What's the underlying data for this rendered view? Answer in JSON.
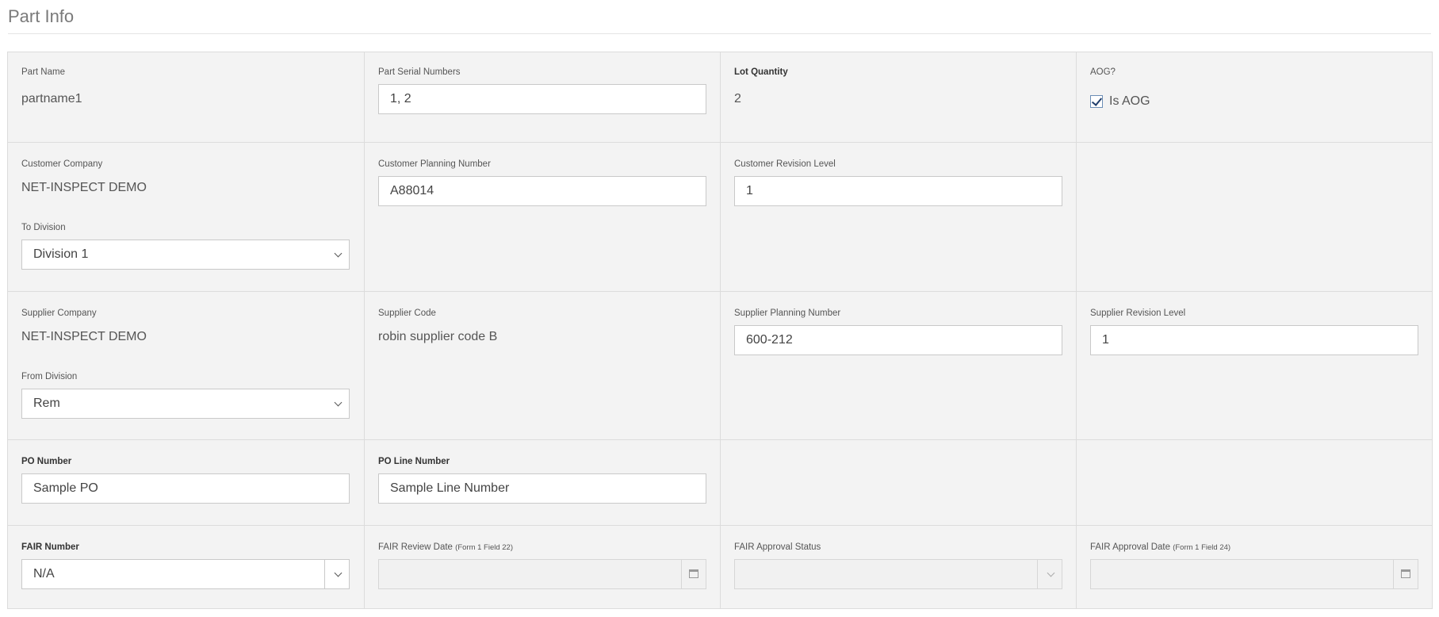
{
  "page": {
    "title": "Part Info"
  },
  "part_name": {
    "label": "Part Name",
    "value": "partname1"
  },
  "part_serial_numbers": {
    "label": "Part Serial Numbers",
    "value": "1, 2"
  },
  "lot_quantity": {
    "label": "Lot Quantity",
    "value": "2"
  },
  "aog": {
    "label": "AOG?",
    "checkbox_label": "Is AOG",
    "checked": true
  },
  "customer_company": {
    "label": "Customer Company",
    "value": "NET-INSPECT DEMO"
  },
  "to_division": {
    "label": "To Division",
    "value": "Division 1"
  },
  "customer_planning_number": {
    "label": "Customer Planning Number",
    "value": "A88014"
  },
  "customer_revision_level": {
    "label": "Customer Revision Level",
    "value": "1"
  },
  "supplier_company": {
    "label": "Supplier Company",
    "value": "NET-INSPECT DEMO"
  },
  "from_division": {
    "label": "From Division",
    "value": "Rem"
  },
  "supplier_code": {
    "label": "Supplier Code",
    "value": "robin supplier code B"
  },
  "supplier_planning_number": {
    "label": "Supplier Planning Number",
    "value": "600-212"
  },
  "supplier_revision_level": {
    "label": "Supplier Revision Level",
    "value": "1"
  },
  "po_number": {
    "label": "PO Number",
    "value": "Sample PO"
  },
  "po_line_number": {
    "label": "PO Line Number",
    "value": "Sample Line Number"
  },
  "fair_number": {
    "label": "FAIR Number",
    "value": "N/A"
  },
  "fair_review_date": {
    "label": "FAIR Review Date",
    "note": "(Form 1 Field 22)",
    "value": ""
  },
  "fair_approval_status": {
    "label": "FAIR Approval Status",
    "value": ""
  },
  "fair_approval_date": {
    "label": "FAIR Approval Date",
    "note": "(Form 1 Field 24)",
    "value": ""
  },
  "icons": {
    "select_caret": "chevron-down-icon",
    "date_picker": "calendar-icon",
    "checkbox": "checkmark-icon"
  },
  "colors": {
    "panel_bg": "#f3f3f3",
    "border": "#dcdcdc",
    "checkbox_check": "#1f3d6b"
  }
}
